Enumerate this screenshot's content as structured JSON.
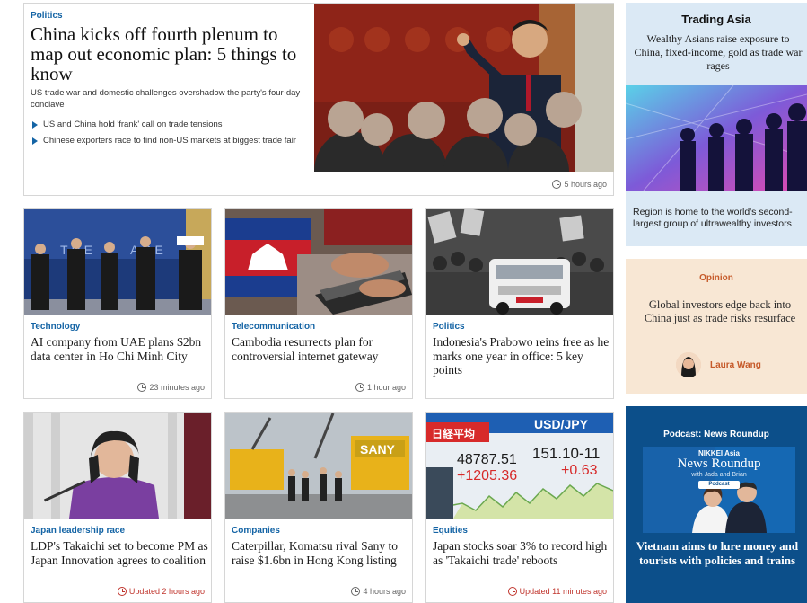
{
  "lead": {
    "tag": "Politics",
    "headline": "China kicks off fourth plenum to map out economic plan: 5 things to know",
    "standfirst": "US trade war and domestic challenges overshadow the party's four-day conclave",
    "bullets": [
      "US and China hold 'frank' call on trade tensions",
      "Chinese exporters race to find non-US markets at biggest trade fair"
    ],
    "time": "5 hours ago"
  },
  "cards": [
    {
      "tag": "Technology",
      "headline": "AI company from UAE plans $2bn data center in Ho Chi Minh City",
      "time": "23 minutes ago"
    },
    {
      "tag": "Telecommunication",
      "headline": "Cambodia resurrects plan for controversial internet gateway",
      "time": "1 hour ago"
    },
    {
      "tag": "Politics",
      "headline": "Indonesia's Prabowo reins free as he marks one year in office: 5 key points",
      "time": ""
    },
    {
      "tag": "Japan leadership race",
      "headline": "LDP's Takaichi set to become PM as Japan Innovation agrees to coalition",
      "time": "Updated 2 hours ago"
    },
    {
      "tag": "Companies",
      "headline": "Caterpillar, Komatsu rival Sany to raise $1.6bn in Hong Kong listing",
      "time": "4 hours ago"
    },
    {
      "tag": "Equities",
      "headline": "Japan stocks soar 3% to record high as 'Takaichi trade' reboots",
      "time": "Updated 11 minutes ago"
    }
  ],
  "image_text": {
    "card1_banner": "THE",
    "card1_banner_tail": "ARE",
    "card5_brand": "SANY",
    "card6_index_label": "日経平均",
    "card6_index_value": "48787.51",
    "card6_index_change": "+1205.36",
    "card6_fx_label": "USD/JPY",
    "card6_fx_value": "151.10-11",
    "card6_fx_change": "+0.63"
  },
  "trading_asia": {
    "title": "Trading Asia",
    "subtitle": "Wealthy Asians raise exposure to China, fixed-income, gold as trade war rages",
    "caption": "Region is home to the world's second-largest group of ultrawealthy investors"
  },
  "opinion": {
    "label": "Opinion",
    "headline": "Global investors edge back into China just as trade risks resurface",
    "author": "Laura Wang"
  },
  "podcast": {
    "label": "Podcast: News Roundup",
    "brand": "NIKKEI Asia",
    "show": "News Roundup",
    "hosts": "with Jada and Brian",
    "pill": "Podcast",
    "headline": "Vietnam aims to lure money and tourists with policies and trains"
  },
  "colors": {
    "accent": "#1464a5",
    "updated": "#c0352d",
    "trading_bg": "#dbe9f5",
    "opinion_bg": "#f8e7d4",
    "opinion_accent": "#c65a2a",
    "podcast_bg": "#0c4f8a"
  },
  "icons": [
    "clock-icon",
    "bullet-triangle-icon"
  ]
}
